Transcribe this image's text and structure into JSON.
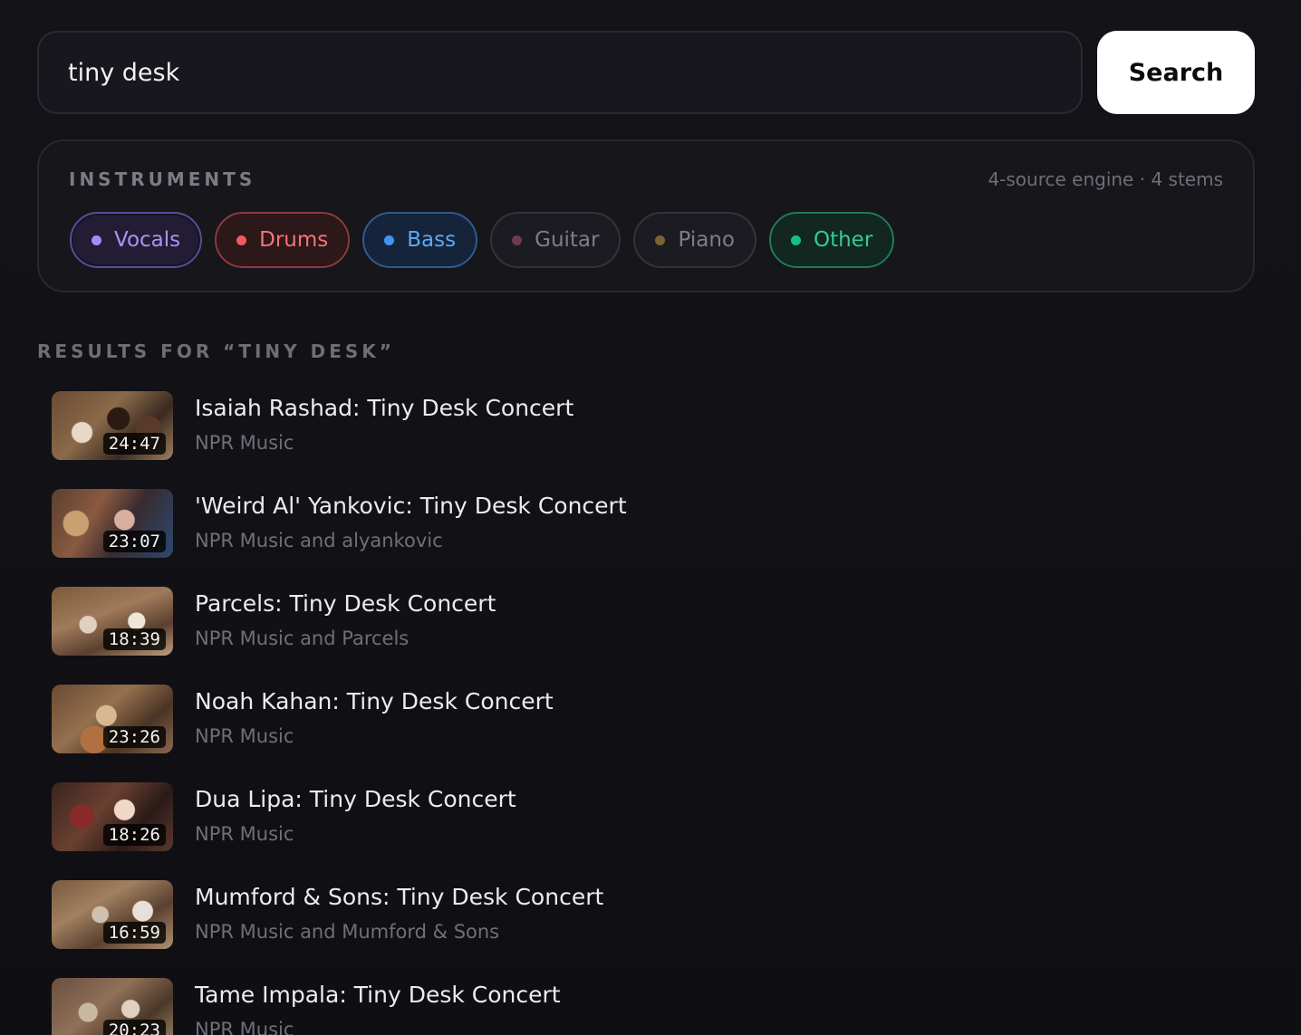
{
  "search": {
    "value": "tiny desk",
    "button_label": "Search"
  },
  "instruments": {
    "title": "INSTRUMENTS",
    "meta": "4-source engine · 4 stems",
    "chips": [
      {
        "label": "Vocals",
        "active": true,
        "color": "#a48cf8"
      },
      {
        "label": "Drums",
        "active": true,
        "color": "#f15a5e"
      },
      {
        "label": "Bass",
        "active": true,
        "color": "#3f95f2"
      },
      {
        "label": "Guitar",
        "active": false,
        "color": "#6e3a4f"
      },
      {
        "label": "Piano",
        "active": false,
        "color": "#7a6432"
      },
      {
        "label": "Other",
        "active": true,
        "color": "#18c080"
      }
    ]
  },
  "results": {
    "heading": "RESULTS FOR “TINY DESK”",
    "items": [
      {
        "title": "Isaiah Rashad: Tiny Desk Concert",
        "channel": "NPR Music",
        "duration": "24:47"
      },
      {
        "title": "'Weird Al' Yankovic: Tiny Desk Concert",
        "channel": "NPR Music and alyankovic",
        "duration": "23:07"
      },
      {
        "title": "Parcels: Tiny Desk Concert",
        "channel": "NPR Music and Parcels",
        "duration": "18:39"
      },
      {
        "title": "Noah Kahan: Tiny Desk Concert",
        "channel": "NPR Music",
        "duration": "23:26"
      },
      {
        "title": "Dua Lipa: Tiny Desk Concert",
        "channel": "NPR Music",
        "duration": "18:26"
      },
      {
        "title": "Mumford & Sons: Tiny Desk Concert",
        "channel": "NPR Music and Mumford & Sons",
        "duration": "16:59"
      },
      {
        "title": "Tame Impala: Tiny Desk Concert",
        "channel": "NPR Music",
        "duration": "20:23"
      }
    ]
  }
}
